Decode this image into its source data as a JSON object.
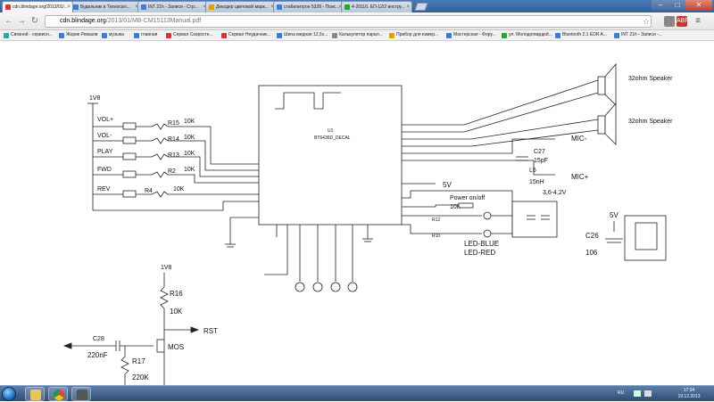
{
  "browser": {
    "tabs": [
      {
        "label": "cdn.blindage.org/2013/01/...",
        "favicon_color": "#d33",
        "active": true
      },
      {
        "label": "Будильник в Техносил...",
        "favicon_color": "#3a7bd5",
        "active": false
      },
      {
        "label": "INT 21h - Записи - Стр...",
        "favicon_color": "#3a7bd5",
        "active": false
      },
      {
        "label": "Декодер цветовой марк...",
        "favicon_color": "#e0a000",
        "active": false
      },
      {
        "label": "стабилитрон 5328 - Поис...",
        "favicon_color": "#3a7bd5",
        "active": false
      },
      {
        "label": "4-20116. ЕП-12/2 инстру...",
        "favicon_color": "#2a2",
        "active": false
      }
    ],
    "window_controls": {
      "minimize": "–",
      "maximize": "□",
      "close": "✕"
    },
    "address": {
      "domain": "cdn.blindage.org",
      "path": "/2013/01/MB-CM15113Manual.pdf"
    },
    "toolbar_icons": {
      "adblock": "ABP",
      "menu": "≡"
    },
    "bookmarks": [
      {
        "label": "Связной - сервисн...",
        "color": "#2aa"
      },
      {
        "label": "Жорик Ревазов",
        "color": "#3a7bd5"
      },
      {
        "label": "музыка",
        "color": "#3a7bd5"
      },
      {
        "label": "главная",
        "color": "#3a7bd5"
      },
      {
        "label": "Сервал Скоросте...",
        "color": "#d33"
      },
      {
        "label": "Сервал Неудачник...",
        "color": "#d33"
      },
      {
        "label": "Шина медная 12,5х...",
        "color": "#3a7bd5"
      },
      {
        "label": "Калькулятор парал...",
        "color": "#888"
      },
      {
        "label": "Прибор для измер...",
        "color": "#e0a000"
      },
      {
        "label": "Мастерская - Фору...",
        "color": "#3a7bd5"
      },
      {
        "label": "ул. Молодогвардей...",
        "color": "#2a2"
      },
      {
        "label": "Bluetooth 2.1 EDR A...",
        "color": "#3a7bd5"
      },
      {
        "label": "INT 21h - Записи -...",
        "color": "#3a7bd5"
      }
    ]
  },
  "schematic": {
    "supply_top": "1V8",
    "buttons": [
      {
        "name": "VOL+",
        "ref": "R15",
        "value": "10K"
      },
      {
        "name": "VOL-",
        "ref": "R14",
        "value": "10K"
      },
      {
        "name": "PLAY",
        "ref": "R13",
        "value": "10K"
      },
      {
        "name": "FWD",
        "ref": "R2",
        "value": "10K"
      },
      {
        "name": "REV",
        "ref": "R4",
        "value": "10K"
      }
    ],
    "chip": {
      "ref": "U1",
      "part": "BT6436D_DECAL"
    },
    "speakers": [
      "32ohm Speaker",
      "32ohm Speaker"
    ],
    "mic_minus": "MIC-",
    "mic_plus": "MIC+",
    "c27": {
      "ref": "C27",
      "value": "15pF"
    },
    "l6": {
      "ref": "L6",
      "value": "15nH"
    },
    "v5": "5V",
    "power": {
      "label": "Power on/off",
      "value": "10K"
    },
    "r12": "R12",
    "r10": "R10",
    "leds": [
      "LED-BLUE",
      "LED-RED"
    ],
    "battery": "3,6-4,2V",
    "c26": {
      "ref": "C26",
      "value": "106"
    },
    "right_5v": "5V",
    "bottom_supply": "1V8",
    "r16": {
      "ref": "R16",
      "value": "10K"
    },
    "rst": "RST",
    "c28": {
      "ref": "C28",
      "value": "220nF"
    },
    "mos": "MOS",
    "r17": {
      "ref": "R17",
      "value": "220K"
    }
  },
  "taskbar": {
    "clock_time": "17:34",
    "clock_date": "19.12.2013",
    "lang": "RU"
  }
}
